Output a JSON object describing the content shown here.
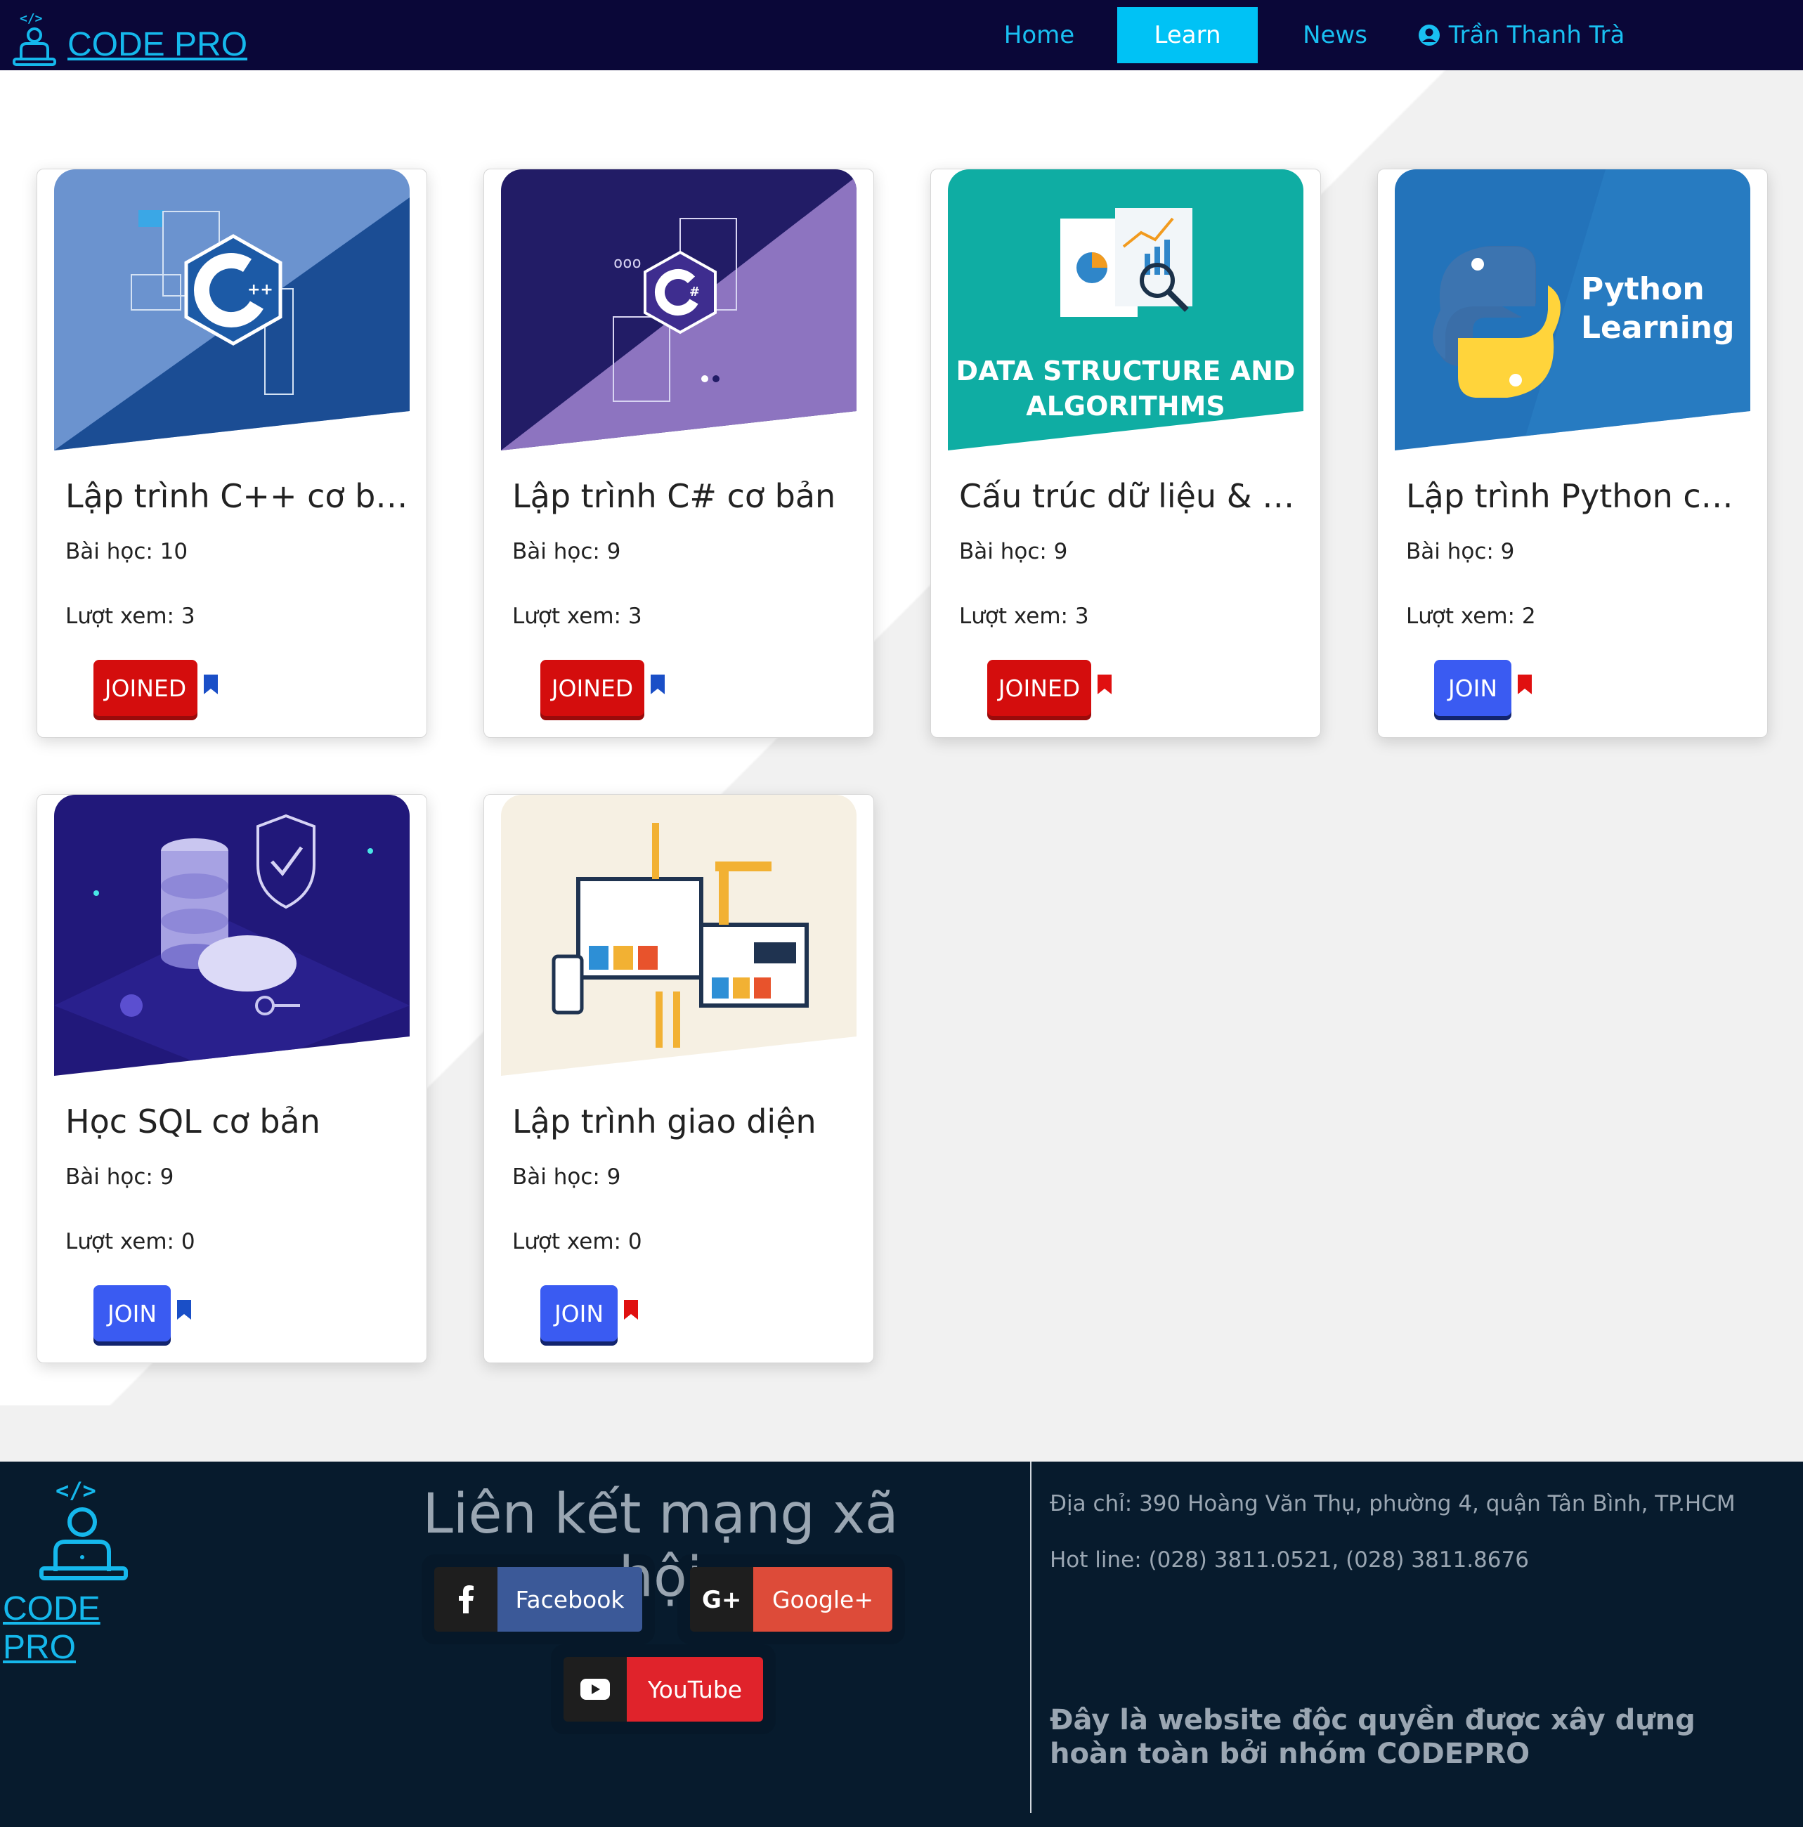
{
  "navbar": {
    "brand": "CODE PRO",
    "items": [
      {
        "label": "Home"
      },
      {
        "label": "Learn"
      },
      {
        "label": "News"
      }
    ],
    "user_name": "Trần Thanh Trà",
    "colors": {
      "background": "#0a0738",
      "accent": "#00c2f5",
      "link": "#19c0f2"
    }
  },
  "courses": [
    {
      "title": "Lập trình C++ cơ bản",
      "lessons": "Bài học: 10",
      "views": "Lượt xem: 3",
      "button": "JOINED",
      "joined": true,
      "bookmark_color": "#1a4fc7",
      "thumb_caption": ""
    },
    {
      "title": "Lập trình C# cơ bản",
      "lessons": "Bài học: 9",
      "views": "Lượt xem: 3",
      "button": "JOINED",
      "joined": true,
      "bookmark_color": "#1a4fc7",
      "thumb_caption": ""
    },
    {
      "title": "Cấu trúc dữ liệu & giải thuật",
      "lessons": "Bài học: 9",
      "views": "Lượt xem: 3",
      "button": "JOINED",
      "joined": true,
      "bookmark_color": "#e01010",
      "thumb_caption_1": "DATA STRUCTURE AND",
      "thumb_caption_2": "ALGORITHMS"
    },
    {
      "title": "Lập trình Python cơ bản",
      "lessons": "Bài học: 9",
      "views": "Lượt xem: 2",
      "button": "JOIN",
      "joined": false,
      "bookmark_color": "#e01010",
      "thumb_caption_1": "Python",
      "thumb_caption_2": "Learning"
    },
    {
      "title": "Học SQL cơ bản",
      "lessons": "Bài học: 9",
      "views": "Lượt xem: 0",
      "button": "JOIN",
      "joined": false,
      "bookmark_color": "#1a4fc7"
    },
    {
      "title": "Lập trình giao diện",
      "lessons": "Bài học: 9",
      "views": "Lượt xem: 0",
      "button": "JOIN",
      "joined": false,
      "bookmark_color": "#e01010"
    }
  ],
  "footer": {
    "brand": "CODE PRO",
    "social_title": "Liên kết mạng xã hội",
    "social": [
      {
        "label": "Facebook",
        "color": "#3b5998"
      },
      {
        "label": "Google+",
        "color": "#dd4b39"
      },
      {
        "label": "YouTube",
        "color": "#e0232b"
      }
    ],
    "address": "Địa chỉ: 390 Hoàng Văn Thụ, phường 4, quận Tân Bình, TP.HCM",
    "hotline": "Hot line: (028) 3811.0521, (028) 3811.8676",
    "exclusive": "Đây là website độc quyền được xây dựng hoàn toàn bởi nhóm CODEPRO"
  }
}
